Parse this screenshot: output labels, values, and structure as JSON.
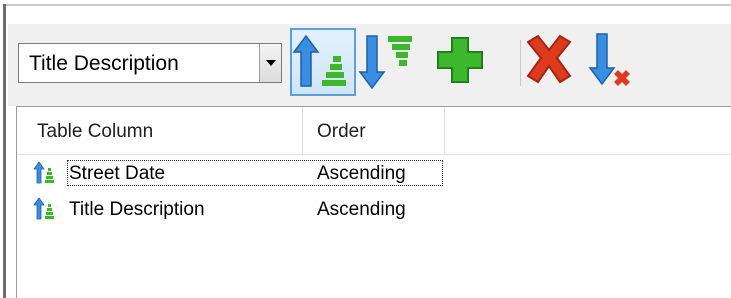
{
  "toolbar": {
    "sort_column_select": {
      "value": "Title Description"
    },
    "buttons": [
      {
        "name": "sort-ascending-button",
        "icon": "sort-ascending-icon",
        "active": true
      },
      {
        "name": "sort-descending-button",
        "icon": "sort-descending-icon",
        "active": false
      },
      {
        "name": "add-sort-button",
        "icon": "add-plus-icon",
        "active": false
      },
      {
        "name": "remove-sort-button",
        "icon": "delete-x-icon",
        "active": false
      },
      {
        "name": "clear-sort-button",
        "icon": "clear-sort-icon",
        "active": false
      }
    ]
  },
  "grid": {
    "columns": [
      "Table Column",
      "Order"
    ],
    "rows": [
      {
        "column": "Street Date",
        "order": "Ascending",
        "icon": "sort-ascending-icon",
        "selected": true
      },
      {
        "column": "Title Description",
        "order": "Ascending",
        "icon": "sort-ascending-icon",
        "selected": false
      }
    ]
  },
  "colors": {
    "accent_blue": "#2f7fd2",
    "accent_green": "#3cb82c",
    "delete_red": "#e03a1e",
    "selection_border": "#5aa0dc"
  }
}
